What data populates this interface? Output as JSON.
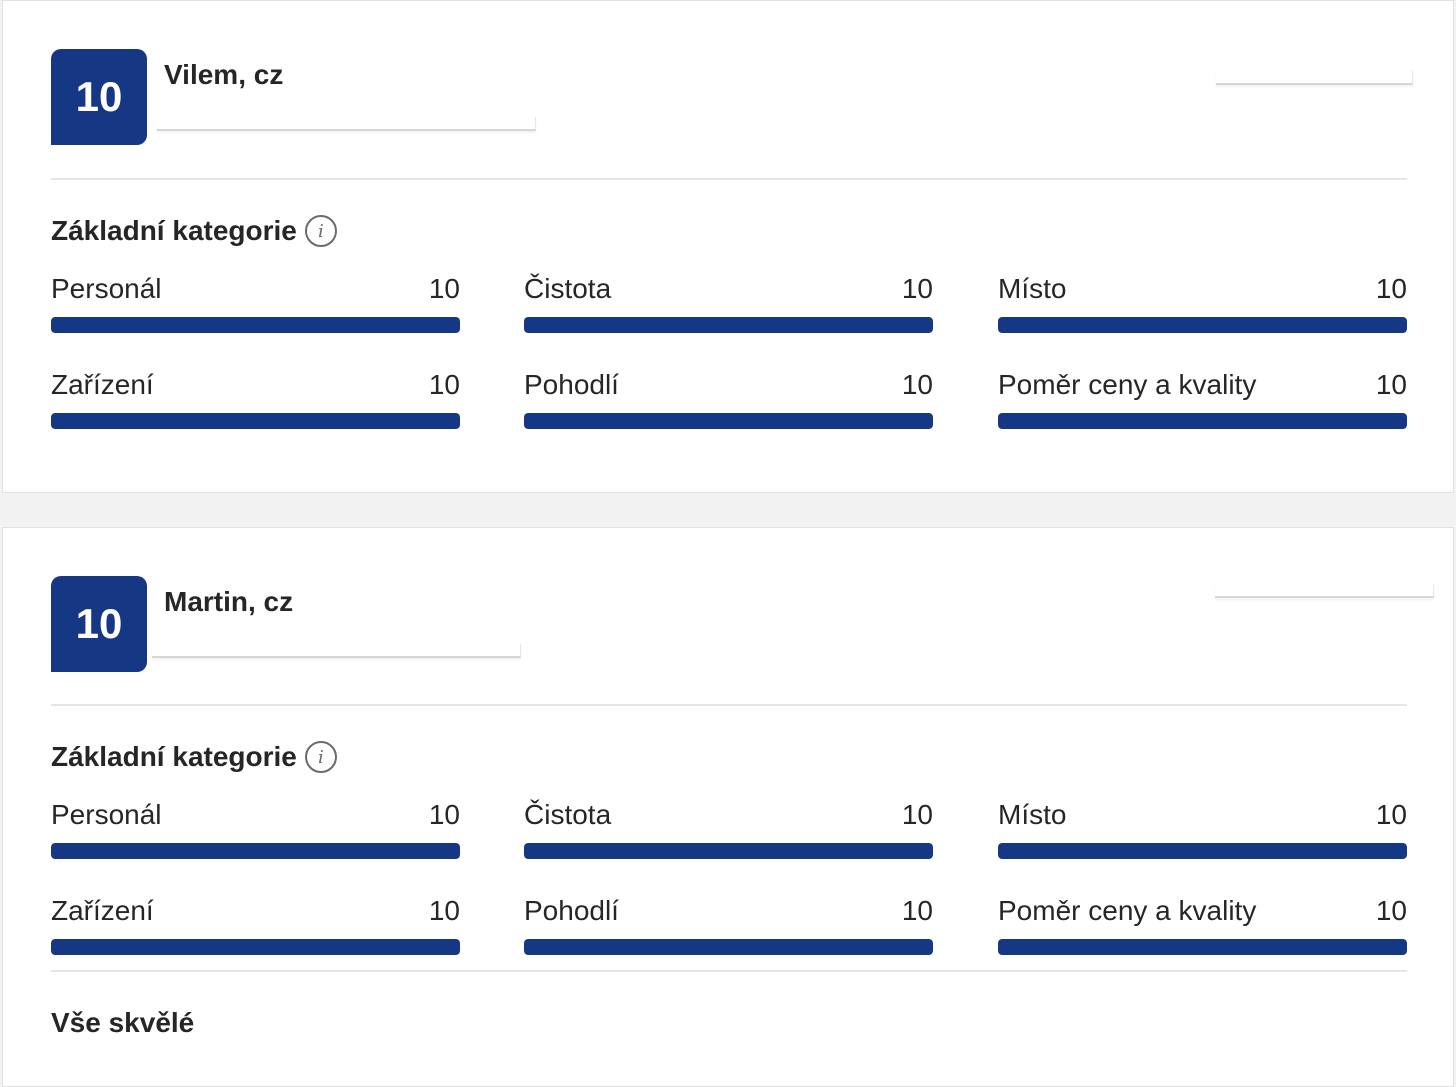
{
  "colors": {
    "accent": "#163884"
  },
  "reviews": [
    {
      "score": "10",
      "name": "Vilem, cz",
      "categories_title": "Základní kategorie",
      "categories": [
        {
          "label": "Personál",
          "value": "10",
          "fraction": 1.0
        },
        {
          "label": "Čistota",
          "value": "10",
          "fraction": 1.0
        },
        {
          "label": "Místo",
          "value": "10",
          "fraction": 1.0
        },
        {
          "label": "Zařízení",
          "value": "10",
          "fraction": 1.0
        },
        {
          "label": "Pohodlí",
          "value": "10",
          "fraction": 1.0
        },
        {
          "label": "Poměr ceny a kvality",
          "value": "10",
          "fraction": 1.0
        }
      ]
    },
    {
      "score": "10",
      "name": "Martin, cz",
      "categories_title": "Základní kategorie",
      "categories": [
        {
          "label": "Personál",
          "value": "10",
          "fraction": 1.0
        },
        {
          "label": "Čistota",
          "value": "10",
          "fraction": 1.0
        },
        {
          "label": "Místo",
          "value": "10",
          "fraction": 1.0
        },
        {
          "label": "Zařízení",
          "value": "10",
          "fraction": 1.0
        },
        {
          "label": "Pohodlí",
          "value": "10",
          "fraction": 1.0
        },
        {
          "label": "Poměr ceny a kvality",
          "value": "10",
          "fraction": 1.0
        }
      ],
      "review_title": "Vše skvělé"
    }
  ]
}
